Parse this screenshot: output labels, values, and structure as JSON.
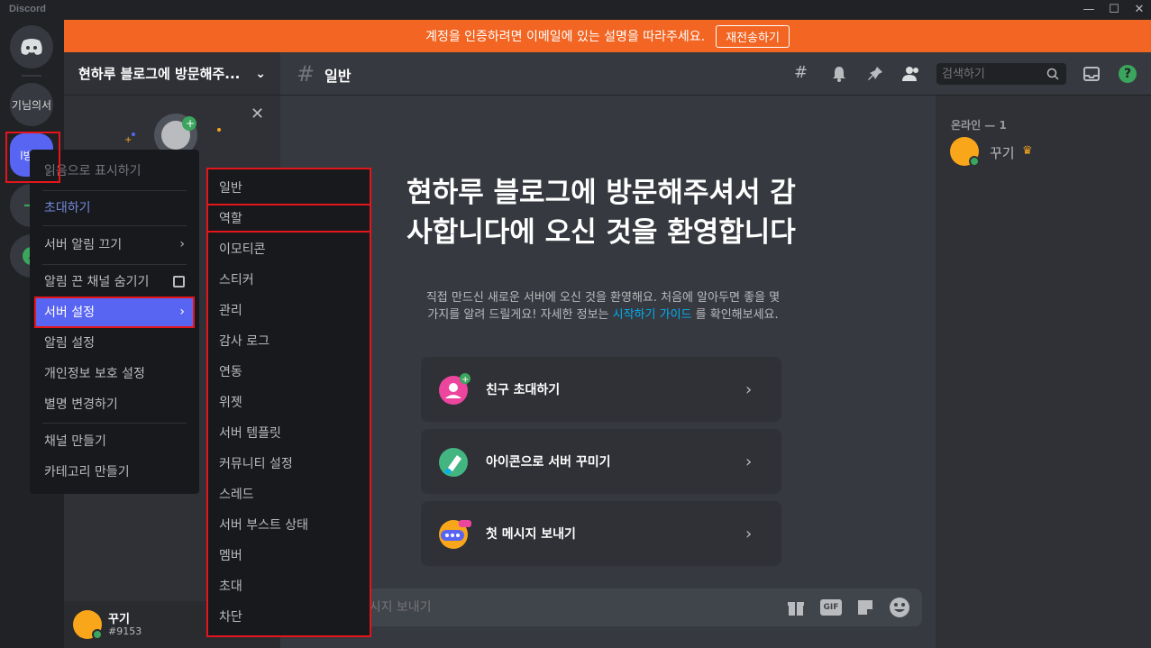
{
  "app": {
    "title": "Discord"
  },
  "window_controls": {
    "minimize": "—",
    "maximize": "☐",
    "close": "✕"
  },
  "banner": {
    "message": "계정을 인증하려면 이메일에 있는 설명을 따라주세요.",
    "button": "재전송하기"
  },
  "guilds": [
    {
      "label": "기님의서"
    },
    {
      "label": "l방문"
    }
  ],
  "server": {
    "name": "현하루 블로그에 방문해주..."
  },
  "channel": {
    "name": "일반"
  },
  "search": {
    "placeholder": "검색하기"
  },
  "welcome": {
    "title": "현하루 블로그에 방문해주셔서 감사합니다에 오신 것을 환영합니다",
    "desc_before": "직접 만드신 새로운 서버에 오신 것을 환영해요. 처음에 알아두면 좋을 몇 가지를 알려 드릴게요! 자세한 정보는",
    "desc_link": "시작하기 가이드",
    "desc_after": "를 확인해보세요."
  },
  "actions": [
    {
      "label": "친구 초대하기",
      "icon": "invite-friends-icon"
    },
    {
      "label": "아이콘으로 서버 꾸미기",
      "icon": "server-icon-brush"
    },
    {
      "label": "첫 메시지 보내기",
      "icon": "first-message-icon"
    }
  ],
  "message_input": {
    "placeholder": "#일반에 메시지 보내기"
  },
  "members": {
    "section": "온라인 — 1",
    "list": [
      {
        "name": "꾸기"
      }
    ]
  },
  "user": {
    "name": "꾸기",
    "tag": "#9153"
  },
  "context_menu": {
    "mark_read": "읽음으로 표시하기",
    "invite": "초대하기",
    "mute_server": "서버 알림 끄기",
    "hide_muted": "알림 끈 채널 숨기기",
    "server_settings": "서버 설정",
    "notification_settings": "알림 설정",
    "privacy_settings": "개인정보 보호 설정",
    "change_nickname": "별명 변경하기",
    "create_channel": "채널 만들기",
    "create_category": "카테고리 만들기"
  },
  "submenu": [
    "일반",
    "역할",
    "이모티콘",
    "스티커",
    "관리",
    "감사 로그",
    "연동",
    "위젯",
    "서버 템플릿",
    "커뮤니티 설정",
    "스레드",
    "서버 부스트 상태",
    "멤버",
    "초대",
    "차단"
  ],
  "colors": {
    "accent": "#5865f2",
    "banner": "#f26522",
    "link": "#00aff4",
    "highlight_box": "#e5151c",
    "online": "#3ba55d",
    "avatar": "#faa61a"
  }
}
